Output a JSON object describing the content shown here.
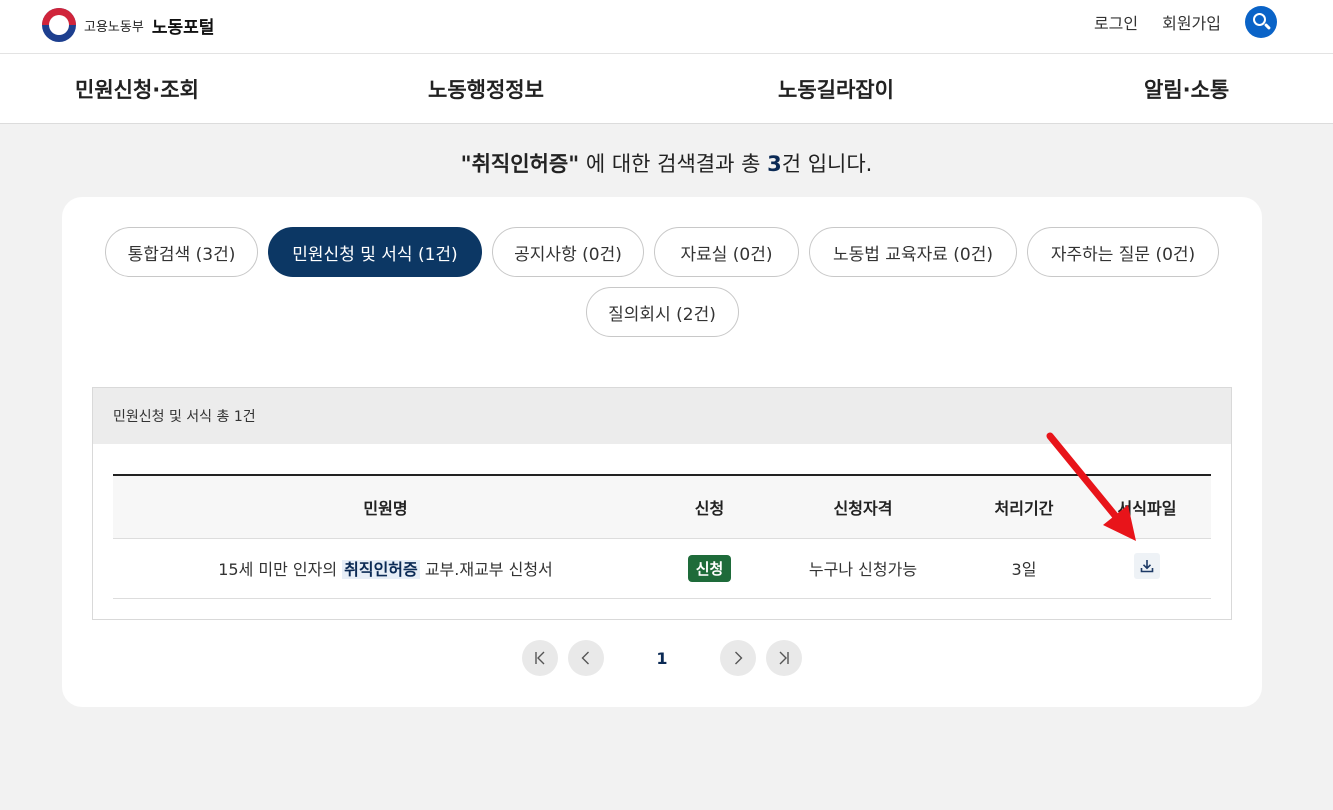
{
  "header": {
    "ministry": "고용노동부",
    "portal": "노동포털",
    "links": {
      "login": "로그인",
      "signup": "회원가입"
    }
  },
  "nav": {
    "items": [
      "민원신청·조회",
      "노동행정정보",
      "노동길라잡이",
      "알림·소통"
    ]
  },
  "summary": {
    "open_quote": "\"",
    "keyword": "취직인허증",
    "close_quote": "\"",
    "text_a": " 에 대한 검색결과 총 ",
    "count": "3",
    "text_b": "건 입니다."
  },
  "tabs": [
    {
      "label": "통합검색 (3건)",
      "active": false
    },
    {
      "label": "민원신청 및 서식 (1건)",
      "active": true
    },
    {
      "label": "공지사항 (0건)",
      "active": false
    },
    {
      "label": "자료실 (0건)",
      "active": false
    },
    {
      "label": "노동법 교육자료 (0건)",
      "active": false
    },
    {
      "label": "자주하는 질문 (0건)",
      "active": false
    },
    {
      "label": "질의회시 (2건)",
      "active": false
    }
  ],
  "section": {
    "title": "민원신청 및 서식 총 1건",
    "columns": [
      "민원명",
      "신청",
      "신청자격",
      "처리기간",
      "서식파일"
    ],
    "rows": [
      {
        "name_before": "15세 미만 인자의 ",
        "name_highlight": "취직인허증",
        "name_after": " 교부.재교부 신청서",
        "apply_label": "신청",
        "qualification": "누구나 신청가능",
        "period": "3일"
      }
    ]
  },
  "pager": {
    "current": "1"
  },
  "colors": {
    "primary_navy": "#0c3764",
    "search_blue": "#0a63c7",
    "apply_green": "#1e6b3a",
    "annotation_red": "#e8141a"
  }
}
